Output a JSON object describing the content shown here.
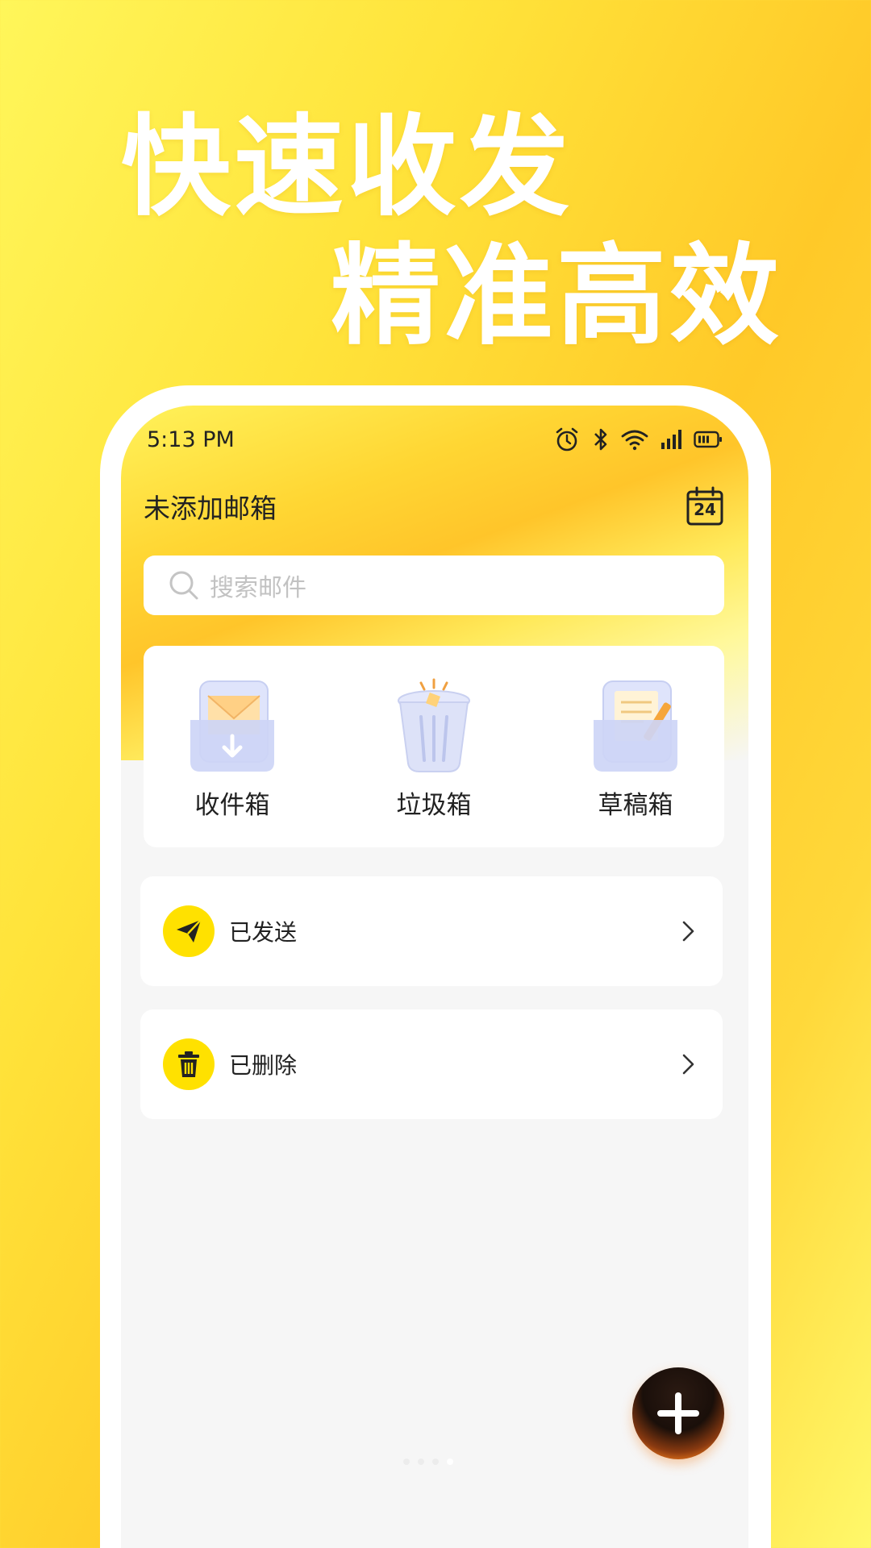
{
  "promo": {
    "line1": "快速收发",
    "line2": "精准高效"
  },
  "status_bar": {
    "time": "5:13 PM",
    "icons": [
      "alarm-icon",
      "bluetooth-icon",
      "wifi-icon",
      "signal-icon",
      "battery-icon"
    ]
  },
  "header": {
    "account_title": "未添加邮箱",
    "calendar_day": "24"
  },
  "search": {
    "placeholder": "搜索邮件"
  },
  "quick_folders": [
    {
      "label": "收件箱",
      "icon": "inbox-icon"
    },
    {
      "label": "垃圾箱",
      "icon": "trash-bin-icon"
    },
    {
      "label": "草稿箱",
      "icon": "drafts-icon"
    }
  ],
  "folders": [
    {
      "label": "已发送",
      "icon": "paper-plane-icon"
    },
    {
      "label": "已删除",
      "icon": "delete-icon"
    }
  ],
  "colors": {
    "accent": "#ffe100",
    "background_yellow": "#ffd633"
  },
  "pagination": {
    "total": 4,
    "active": 4
  }
}
